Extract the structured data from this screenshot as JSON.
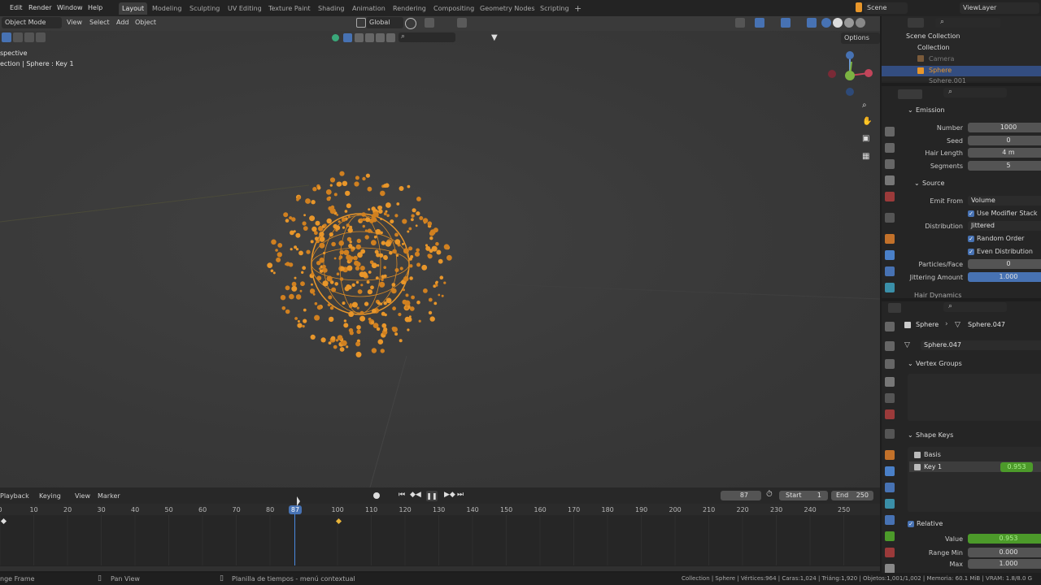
{
  "topbar": {
    "menus": [
      "Edit",
      "Render",
      "Window",
      "Help"
    ],
    "workspaces": [
      "Layout",
      "Modeling",
      "Sculpting",
      "UV Editing",
      "Texture Paint",
      "Shading",
      "Animation",
      "Rendering",
      "Compositing",
      "Geometry Nodes",
      "Scripting"
    ],
    "active_workspace": "Layout",
    "add_tab": "+",
    "scene": "Scene",
    "view_layer": "ViewLayer"
  },
  "viewport": {
    "mode": "Object Mode",
    "menus": [
      "View",
      "Select",
      "Add",
      "Object"
    ],
    "orientation": "Global",
    "options": "Options",
    "overlay_line1": "spective",
    "overlay_line2": "ection | Sphere : Key 1"
  },
  "outliner": {
    "root": "Scene Collection",
    "collection": "Collection",
    "items": [
      "Camera",
      "Sphere",
      "Sphere.001"
    ]
  },
  "particles": {
    "emission_title": "Emission",
    "number_label": "Number",
    "number_value": "1000",
    "seed_label": "Seed",
    "seed_value": "0",
    "hair_length_label": "Hair Length",
    "hair_length_value": "4 m",
    "segments_label": "Segments",
    "segments_value": "5",
    "source_title": "Source",
    "emit_from_label": "Emit From",
    "emit_from_value": "Volume",
    "use_modifier_stack": "Use Modifier Stack",
    "distribution_label": "Distribution",
    "distribution_value": "Jittered",
    "random_order": "Random Order",
    "even_distribution": "Even Distribution",
    "particles_face_label": "Particles/Face",
    "particles_face_value": "0",
    "jittering_label": "Jittering Amount",
    "jittering_value": "1.000",
    "hair_dynamics": "Hair Dynamics"
  },
  "mesh_props": {
    "object": "Sphere",
    "mesh": "Sphere.047",
    "mesh_field": "Sphere.047",
    "vertex_groups_title": "Vertex Groups",
    "shape_keys_title": "Shape Keys",
    "keys": [
      {
        "name": "Basis",
        "value": ""
      },
      {
        "name": "Key 1",
        "value": "0.953"
      }
    ],
    "relative": "Relative",
    "value_label": "Value",
    "value_value": "0.953",
    "range_min_label": "Range Min",
    "range_min_value": "0.000",
    "max_label": "Max",
    "max_value": "1.000"
  },
  "timeline": {
    "menus": [
      "Playback",
      "Keying",
      "View",
      "Marker"
    ],
    "current_frame": "87",
    "start_label": "Start",
    "start_value": "1",
    "end_label": "End",
    "end_value": "250",
    "ticks": [
      "0",
      "10",
      "20",
      "30",
      "40",
      "50",
      "60",
      "70",
      "80",
      "100",
      "110",
      "120",
      "130",
      "140",
      "150",
      "160",
      "170",
      "180",
      "190",
      "200",
      "210",
      "220",
      "230",
      "240",
      "250"
    ],
    "playhead_label": "87"
  },
  "statusbar": {
    "left": "nge Frame",
    "pan": "Pan View",
    "context": "Planilla de tiempos - menú contextual",
    "stats": "Collection | Sphere | Vértices:964 | Caras:1,024 | Triáng:1,920 | Objetos:1,001/1,002 | Memoria: 60.1 MiB | VRAM: 1.8/8.0 G"
  },
  "colors": {
    "accent": "#4772b3",
    "particles": "#e8962a",
    "key_green": "#4c9a2a"
  }
}
